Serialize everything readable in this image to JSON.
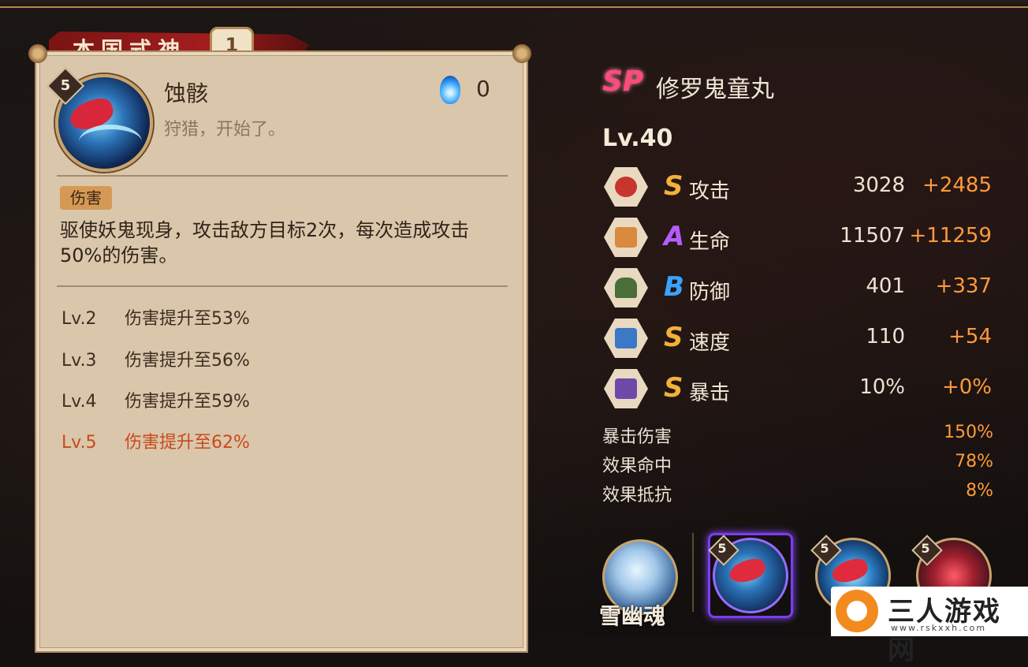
{
  "tab": {
    "title": "本国式神",
    "number": "1"
  },
  "skill": {
    "level": "5",
    "name": "蚀骸",
    "quote": "狩猎，开始了。",
    "orb_count": "0",
    "tag": "伤害",
    "description": "驱使妖鬼现身，攻击敌方目标2次，每次造成攻击50%的伤害。",
    "levels": [
      {
        "lv": "Lv.2",
        "text": "伤害提升至53%"
      },
      {
        "lv": "Lv.3",
        "text": "伤害提升至56%"
      },
      {
        "lv": "Lv.4",
        "text": "伤害提升至59%"
      },
      {
        "lv": "Lv.5",
        "text": "伤害提升至62%"
      }
    ]
  },
  "character": {
    "rarity": "SP",
    "name": "修罗鬼童丸",
    "level": "Lv.40",
    "stats": [
      {
        "icon": "attack-icon",
        "grade": "S",
        "label": "攻击",
        "base": "3028",
        "bonus": "+2485"
      },
      {
        "icon": "health-icon",
        "grade": "A",
        "label": "生命",
        "base": "11507",
        "bonus": "+11259"
      },
      {
        "icon": "defense-icon",
        "grade": "B",
        "label": "防御",
        "base": "401",
        "bonus": "+337"
      },
      {
        "icon": "speed-icon",
        "grade": "S",
        "label": "速度",
        "base": "110",
        "bonus": "+54"
      },
      {
        "icon": "crit-icon",
        "grade": "S",
        "label": "暴击",
        "base": "10%",
        "bonus": "+0%"
      }
    ],
    "sub_stats": [
      {
        "label": "暴击伤害",
        "value": "150%"
      },
      {
        "label": "效果命中",
        "value": "78%"
      },
      {
        "label": "效果抵抗",
        "value": "8%"
      }
    ]
  },
  "portraits": {
    "first_name": "雪幽魂",
    "skill_levels": [
      "5",
      "5",
      "5"
    ]
  },
  "watermark": {
    "text": "三人游戏网",
    "url": "www.rskxxh.com"
  },
  "colors": {
    "accent_orange": "#ff9a3a",
    "active_level": "#c84a1d",
    "grade_s": "#f3b03a",
    "grade_a": "#b45dff",
    "grade_b": "#39a3ff"
  }
}
